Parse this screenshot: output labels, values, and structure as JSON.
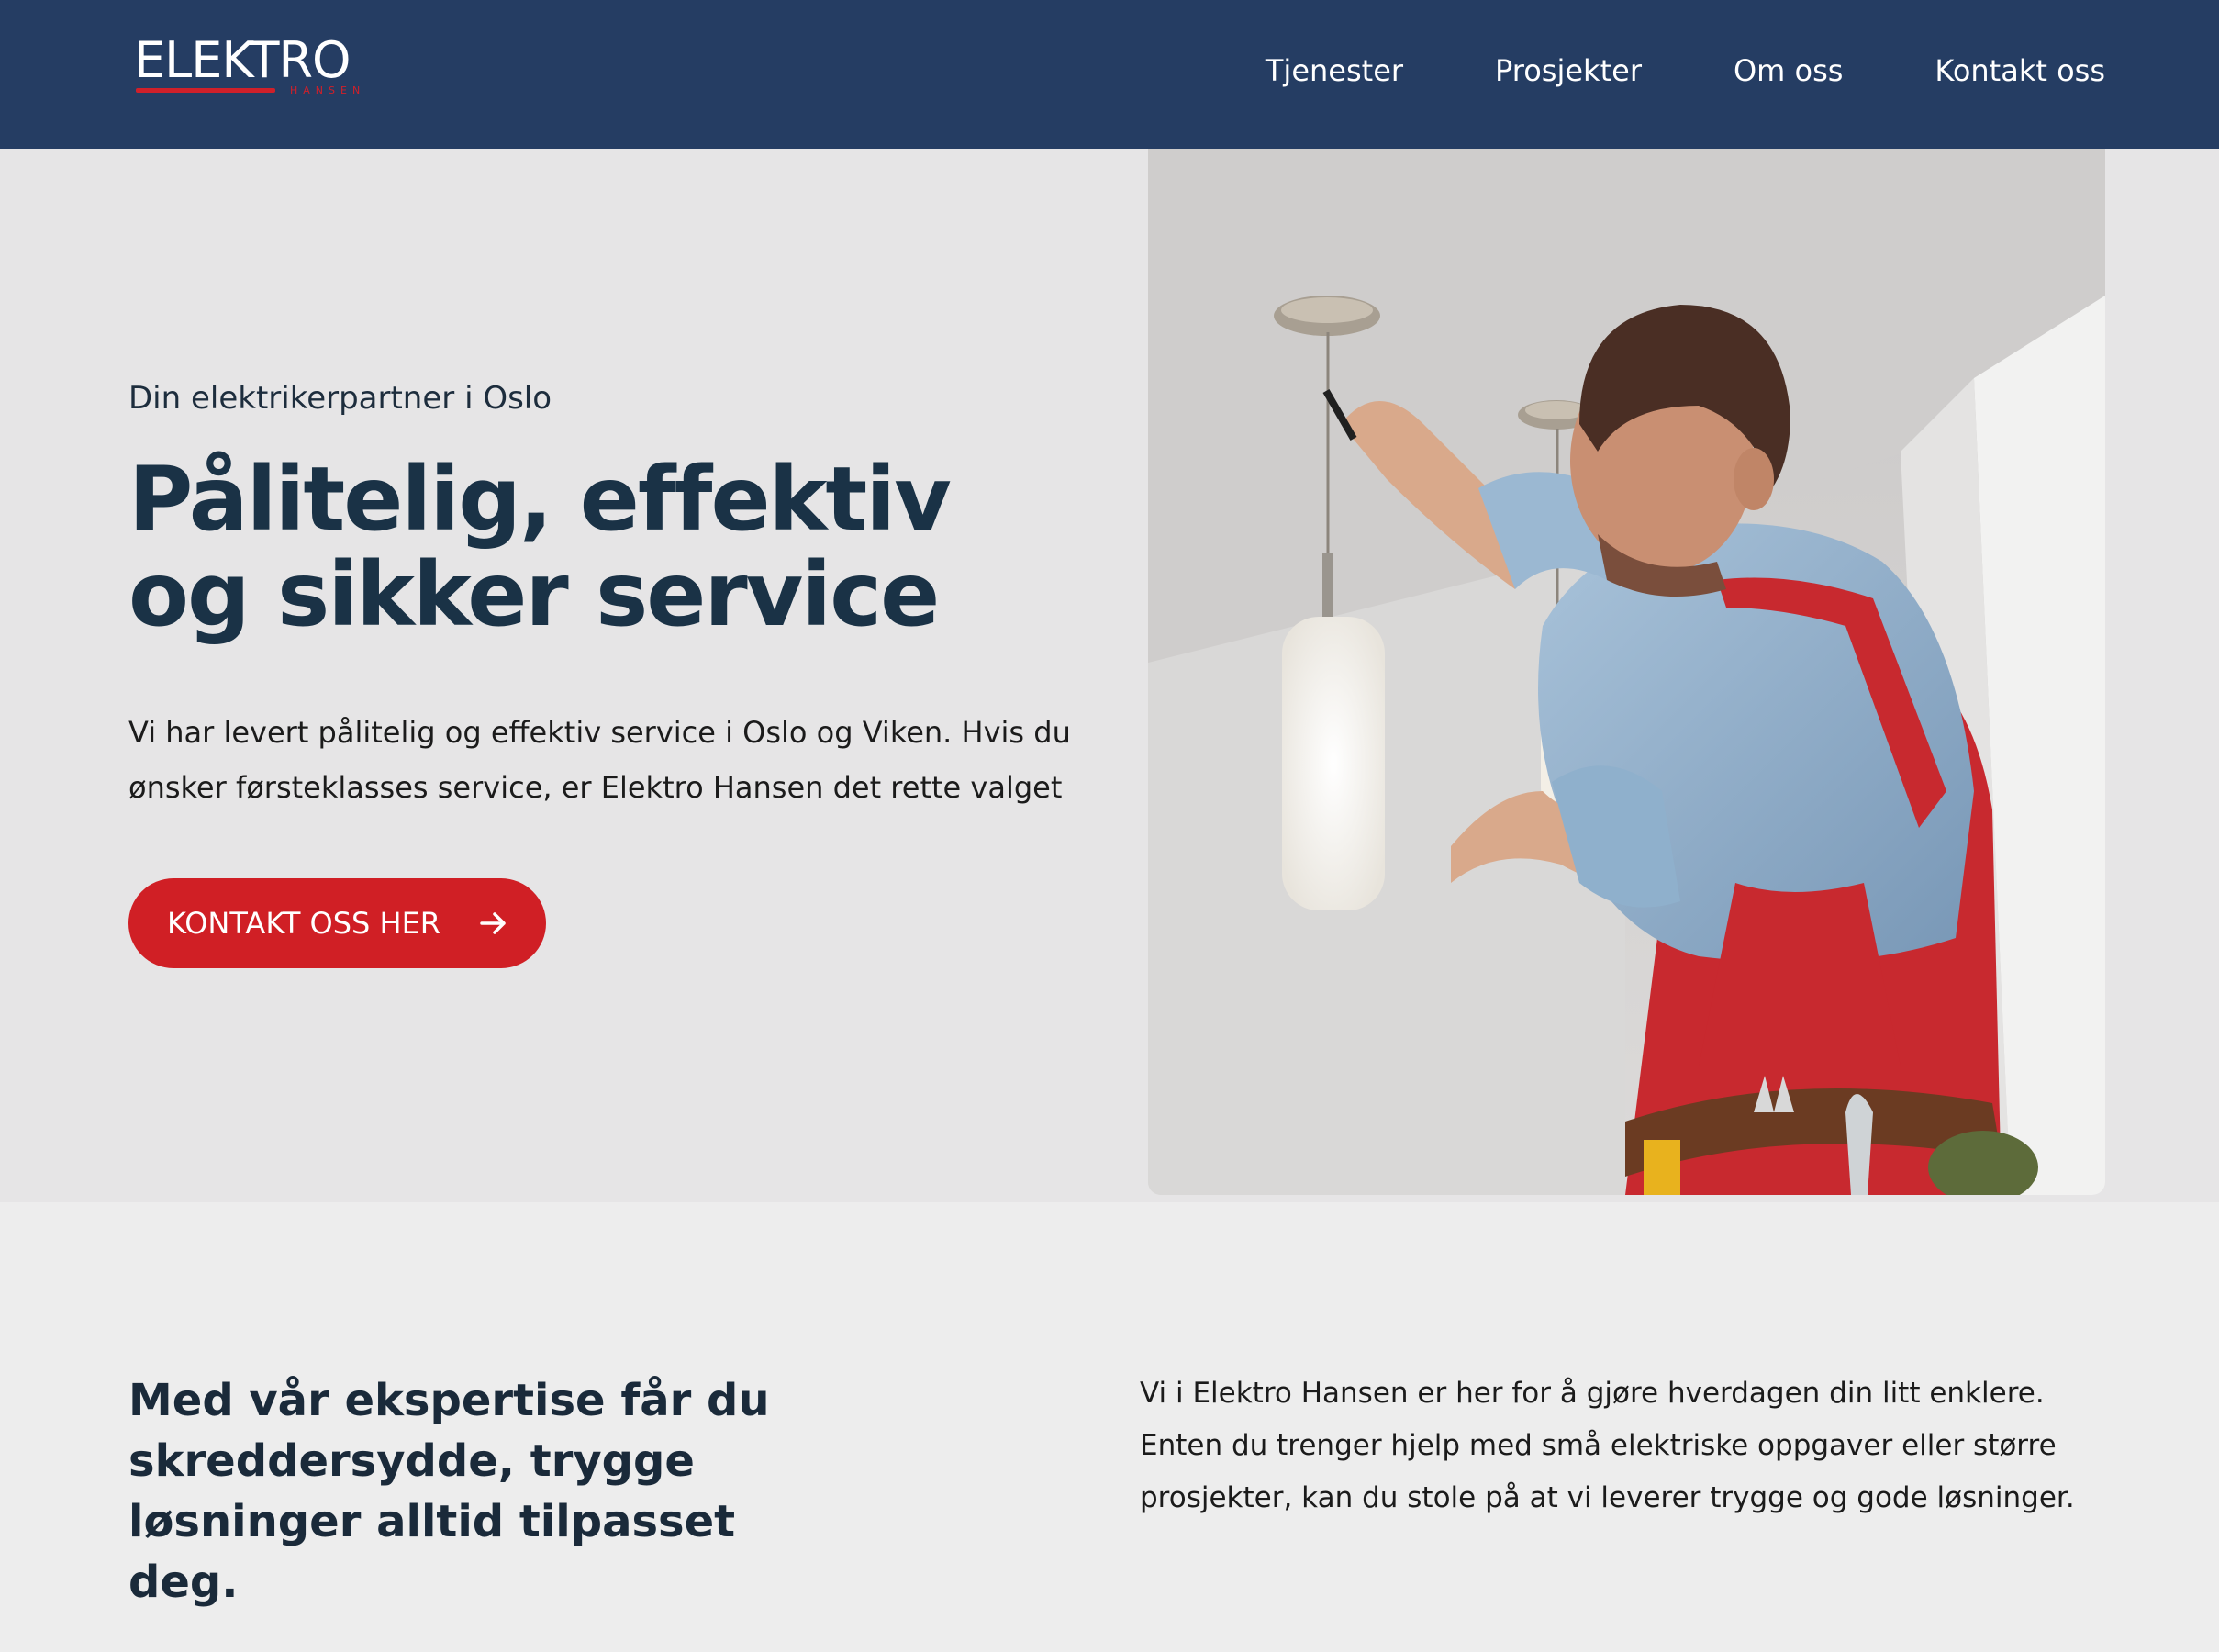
{
  "brand": {
    "name": "ELEKTRO",
    "sub": "HANSEN",
    "navy": "#253d63",
    "red": "#d0202a"
  },
  "nav": {
    "items": [
      "Tjenester",
      "Prosjekter",
      "Om oss",
      "Kontakt oss"
    ]
  },
  "hero": {
    "eyebrow": "Din elektrikerpartner i Oslo",
    "headline_line1": "Pålitelig, effektiv",
    "headline_line2": "og sikker service",
    "intro": "Vi har levert pålitelig og effektiv service i Oslo og Viken. Hvis du ønsker førsteklasses service, er Elektro Hansen det rette valget",
    "cta_label": "KONTAKT OSS HER",
    "cta_icon": "arrow-right-icon"
  },
  "section": {
    "heading": "Med vår ekspertise får du skreddersydde, trygge løsninger alltid tilpasset deg.",
    "text": "Vi i Elektro Hansen er her for å gjøre hverdagen din litt enklere. Enten du trenger hjelp med små elektriske oppgaver eller større prosjekter, kan du stole på at vi leverer trygge og gode løsninger."
  }
}
